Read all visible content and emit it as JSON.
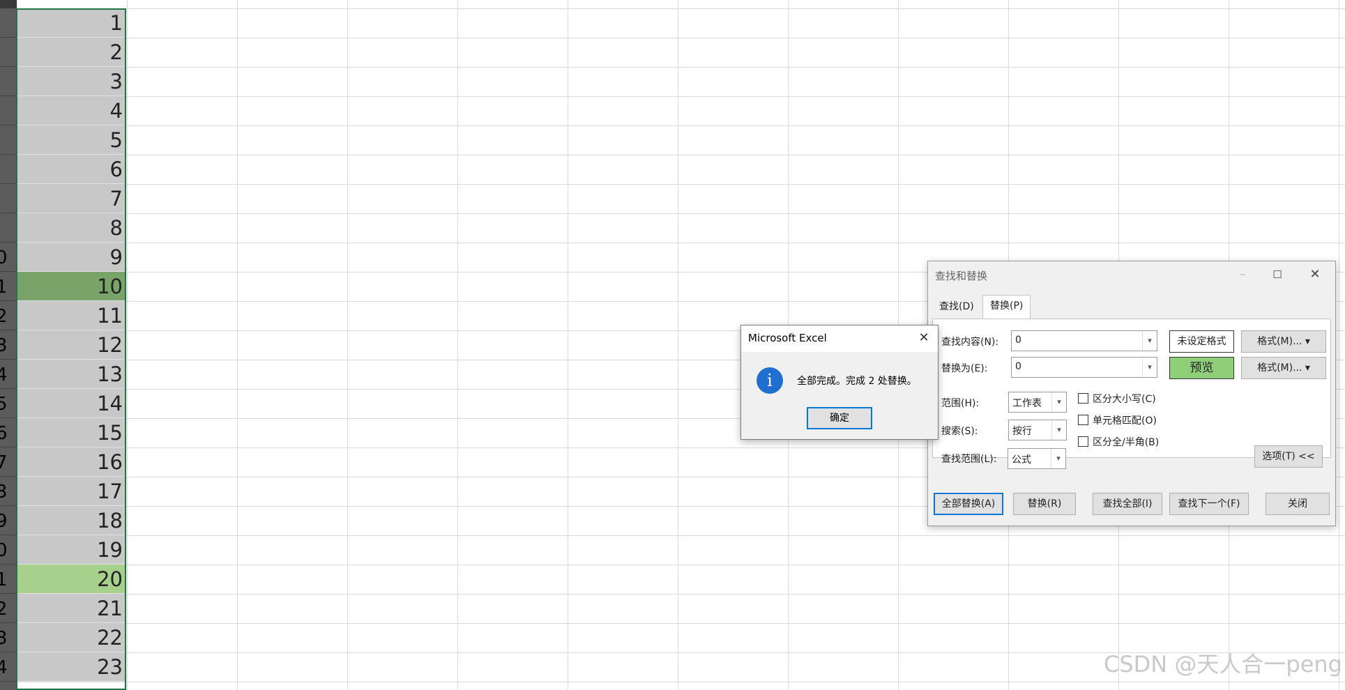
{
  "sheet": {
    "row_numbers": [
      "",
      "",
      "",
      "",
      "",
      "",
      "",
      "",
      "0",
      "1",
      "2",
      "3",
      "4",
      "5",
      "6",
      "7",
      "3",
      "9",
      "0",
      "1",
      "2",
      "3",
      "4"
    ],
    "cells": [
      "1",
      "2",
      "3",
      "4",
      "5",
      "6",
      "7",
      "8",
      "9",
      "10",
      "11",
      "12",
      "13",
      "14",
      "15",
      "16",
      "17",
      "18",
      "19",
      "20",
      "21",
      "22",
      "23"
    ],
    "highlight_dark_row": 10,
    "highlight_light_row": 20,
    "colors": {
      "selected_cell": "#c8c8c8",
      "dark_green": "#7aa36a",
      "light_green": "#a8d08d",
      "selection_border": "#217346"
    }
  },
  "find_replace": {
    "title": "查找和替换",
    "tabs": [
      "查找(D)",
      "替换(P)"
    ],
    "find_label": "查找内容(N):",
    "find_value": "0",
    "replace_label": "替换为(E):",
    "replace_value": "0",
    "no_format_label": "未设定格式",
    "preview_label": "预览",
    "format_button": "格式(M)...",
    "scope_label": "范围(H):",
    "scope_value": "工作表",
    "search_label": "搜索(S):",
    "search_value": "按行",
    "lookin_label": "查找范围(L):",
    "lookin_value": "公式",
    "match_case": "区分大小写(C)",
    "match_cell": "单元格匹配(O)",
    "match_width": "区分全/半角(B)",
    "options_button": "选项(T) <<",
    "buttons": {
      "replace_all": "全部替换(A)",
      "replace": "替换(R)",
      "find_all": "查找全部(I)",
      "find_next": "查找下一个(F)",
      "close": "关闭"
    }
  },
  "message_box": {
    "title": "Microsoft Excel",
    "message": "全部完成。完成 2 处替换。",
    "ok": "确定",
    "icon": "info-icon"
  },
  "watermark": "CSDN @天人合一peng"
}
